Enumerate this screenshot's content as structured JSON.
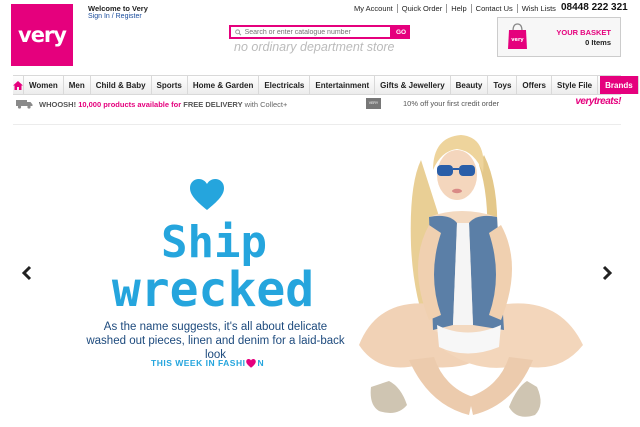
{
  "brand": {
    "logo": "very",
    "accent": "#e5007d",
    "hero_blue": "#25a5dd"
  },
  "header": {
    "welcome": "Welcome to Very",
    "signin": "Sign In / Register",
    "links": [
      "My Account",
      "Quick Order",
      "Help",
      "Contact Us",
      "Wish Lists"
    ],
    "phone": "08448 222 321",
    "search_placeholder": "Search or enter catalogue number",
    "search_button": "GO",
    "tagline": "no ordinary department store"
  },
  "basket": {
    "title": "YOUR BASKET",
    "items": "0 Items",
    "bag_label": "very"
  },
  "nav": {
    "home_icon": "home-icon",
    "items": [
      "Women",
      "Men",
      "Child & Baby",
      "Sports",
      "Home & Garden",
      "Electricals",
      "Entertainment",
      "Gifts & Jewellery",
      "Beauty",
      "Toys",
      "Offers",
      "Style File"
    ],
    "brands": "Brands"
  },
  "promo": {
    "whoosh": "WHOOSH!",
    "text1": "10,000 products available for",
    "free": "FREE DELIVERY",
    "text2": "with Collect+",
    "account_badge": "VERY ACCOUNT",
    "account_text": "10% off your first credit order",
    "treats": "verytreats!"
  },
  "hero": {
    "title_line1": "Ship",
    "title_line2": "wrecked",
    "description": "As the name suggests, it's all about delicate washed out pieces, linen and denim for a laid-back look",
    "link_before": "THIS WEEK IN FASHI",
    "link_after": "N"
  }
}
